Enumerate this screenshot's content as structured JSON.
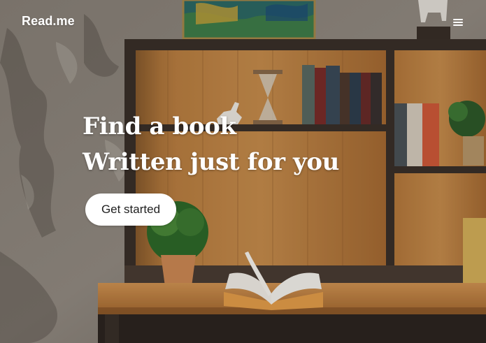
{
  "header": {
    "logo_text": "Read.me",
    "menu_icon": "hamburger-menu-icon"
  },
  "hero": {
    "headline_line1": "Find a book",
    "headline_line2": "Written just for you",
    "cta_label": "Get started",
    "background_description_icon": "bookshelf-photo"
  },
  "colors": {
    "text": "#ffffff",
    "button_bg": "#ffffff",
    "button_text": "#1f1f1f"
  }
}
